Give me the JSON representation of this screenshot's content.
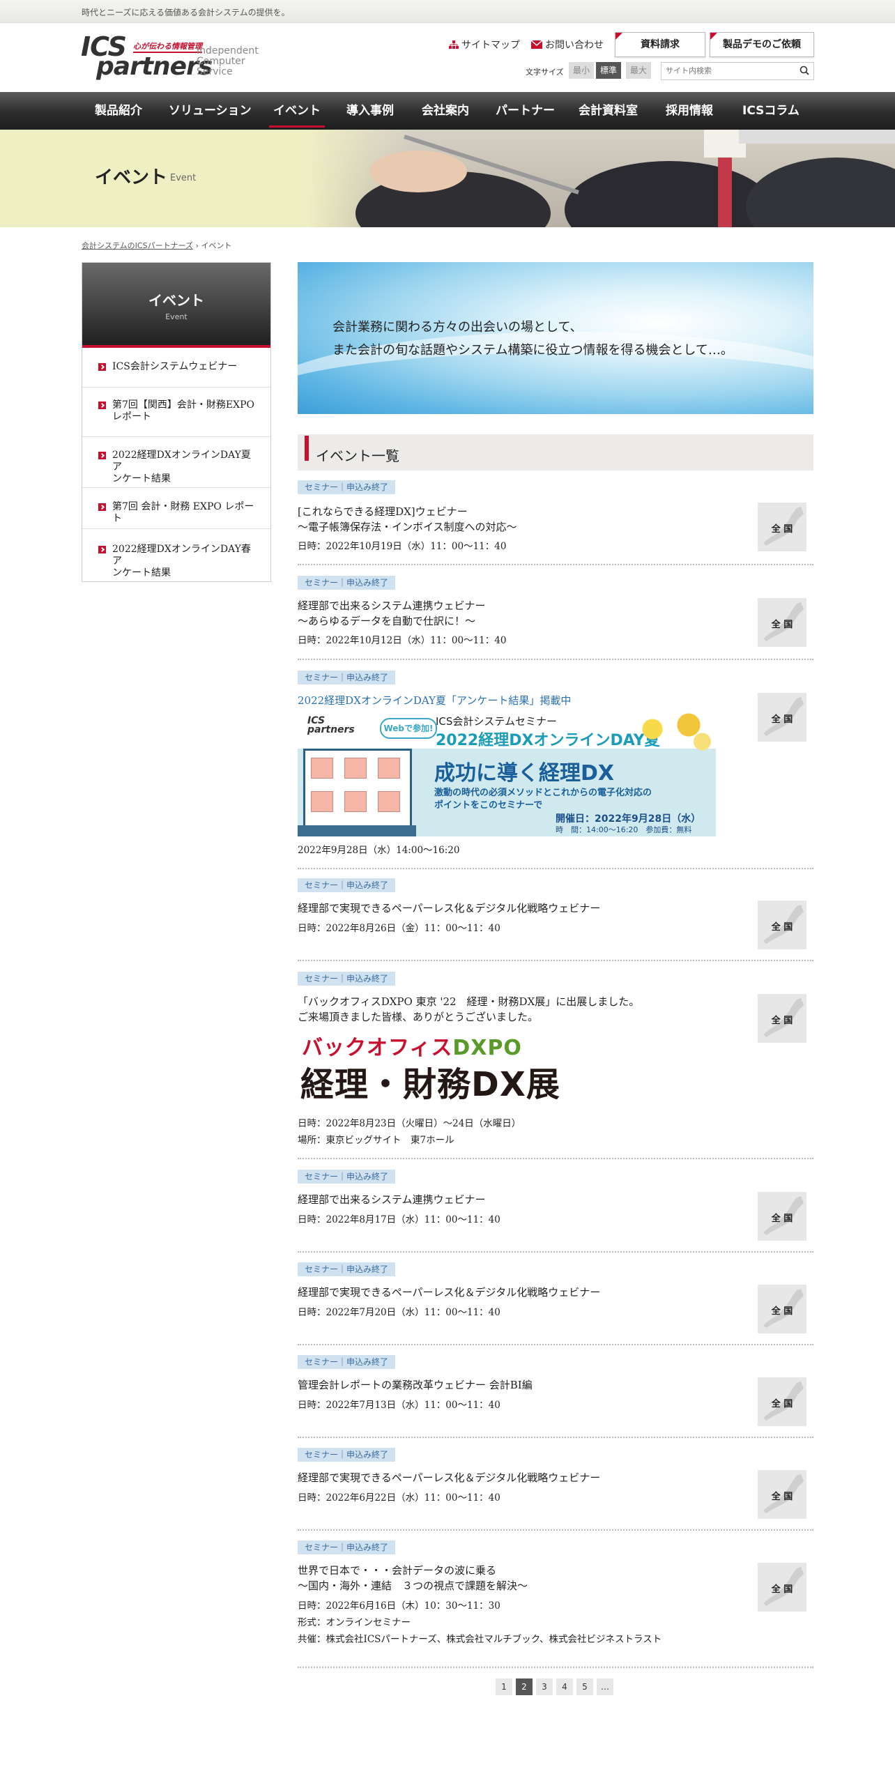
{
  "topbar": {
    "tagline": "時代とニーズに応える価値ある会計システムの提供を。"
  },
  "logo": {
    "line1": "ICS",
    "line2": "partners",
    "tag": "心が伝わる情報管理",
    "sub1": "Independent",
    "sub2": "Computer",
    "sub3": "Service"
  },
  "header": {
    "sitemap": "サイトマップ",
    "contact": "お問い合わせ",
    "btn_docs": "資料請求",
    "btn_demo": "製品デモのご依頼",
    "fontsize_label": "文字サイズ",
    "fs_small": "最小",
    "fs_normal": "標準",
    "fs_large": "最大",
    "search_placeholder": "サイト内検索"
  },
  "nav": [
    "製品紹介",
    "ソリューション",
    "イベント",
    "導入事例",
    "会社案内",
    "パートナー",
    "会計資料室",
    "採用情報",
    "ICSコラム"
  ],
  "hero": {
    "title": "イベント",
    "en": "Event"
  },
  "breadcrumb": {
    "home": "会計システムのICSパートナーズ",
    "sep": "›",
    "current": "イベント"
  },
  "sidebar": {
    "title": "イベント",
    "en": "Event",
    "items": [
      [
        "ICS会計システムウェビナー"
      ],
      [
        "第7回【関西】会計・財務EXPO",
        "レポート"
      ],
      [
        "2022経理DXオンラインDAY夏 ア",
        "ンケート結果"
      ],
      [
        "第7回 会計・財務 EXPO レポート"
      ],
      [
        "2022経理DXオンラインDAY春 ア",
        "ンケート結果"
      ]
    ]
  },
  "banner": {
    "line1": "会計業務に関わる方々の出会いの場として、",
    "line2": "また会計の旬な話題やシステム構築に役立つ情報を得る機会として…。"
  },
  "section_title": "イベント一覧",
  "badge": "セミナー｜申込み終了",
  "map_label": "全 国",
  "events": [
    {
      "lines": [
        "[これならできる経理DX]ウェビナー",
        "～電子帳簿保存法・インボイス制度への対応～"
      ],
      "date": [
        "日時：2022年10月19日（水）11：00～11：40"
      ]
    },
    {
      "lines": [
        "経理部で出来るシステム連携ウェビナー",
        "～あらゆるデータを自動で仕訳に！～"
      ],
      "date": [
        "日時：2022年10月12日（水）11：00～11：40"
      ]
    },
    {
      "lines": [
        "2022経理DXオンラインDAY夏「アンケート結果」掲載中"
      ],
      "date": [
        "2022年9月28日（水）14:00～16:20"
      ]
    },
    {
      "lines": [
        "経理部で実現できるペーパーレス化＆デジタル化戦略ウェビナー"
      ],
      "date": [
        "日時：2022年8月26日（金）11：00～11：40"
      ]
    },
    {
      "lines": [
        "「バックオフィスDXPO 東京 '22　経理・財務DX展」に出展しました。",
        "ご来場頂きました皆様、ありがとうございました。"
      ],
      "date": [
        "日時：2022年8月23日（火曜日）～24日（水曜日）",
        "場所：東京ビッグサイト　東7ホール"
      ]
    },
    {
      "lines": [
        "経理部で出来るシステム連携ウェビナー"
      ],
      "date": [
        "日時：2022年8月17日（水）11：00～11：40"
      ]
    },
    {
      "lines": [
        "経理部で実現できるペーパーレス化＆デジタル化戦略ウェビナー"
      ],
      "date": [
        "日時：2022年7月20日（水）11：00～11：40"
      ]
    },
    {
      "lines": [
        "管理会計レポートの業務改革ウェビナー 会計BI編"
      ],
      "date": [
        "日時：2022年7月13日（水）11：00～11：40"
      ]
    },
    {
      "lines": [
        "経理部で実現できるペーパーレス化＆デジタル化戦略ウェビナー"
      ],
      "date": [
        "日時：2022年6月22日（水）11：00～11：40"
      ]
    },
    {
      "lines": [
        "世界で日本で・・・会計データの波に乗る",
        "～国内・海外・連結　３つの視点で課題を解決～"
      ],
      "date": [
        "日時：2022年6月16日（木）10：30～11：30",
        "形式：オンラインセミナー",
        "共催：株式会社ICSパートナーズ、株式会社マルチブック、株式会社ビジネストラスト"
      ]
    }
  ],
  "seminar_banner": {
    "logo1": "ICS",
    "logo2": "partners",
    "pill": "Webで参加!",
    "s1": "ICS会計システムセミナー",
    "s2": "2022経理DXオンラインDAY夏",
    "main": "成功に導く経理DX",
    "sub1": "激動の時代の必須メソッドとこれからの電子化対応の",
    "sub2": "ポイントをこのセミナーで",
    "d1": "開催日：2022年9月28日（水）",
    "d2": "時　間：14:00～16:20　参加費：無料"
  },
  "expo": {
    "line1a": "バックオフィス",
    "line1b": "DXPO",
    "line2": "経理・財務DX展"
  },
  "pagination": [
    "1",
    "2",
    "3",
    "4",
    "5",
    "…"
  ],
  "current_page": "2",
  "colors": {
    "accent": "#c8102e",
    "link": "#2a6fb0",
    "badge_bg": "#d0e1ef"
  }
}
